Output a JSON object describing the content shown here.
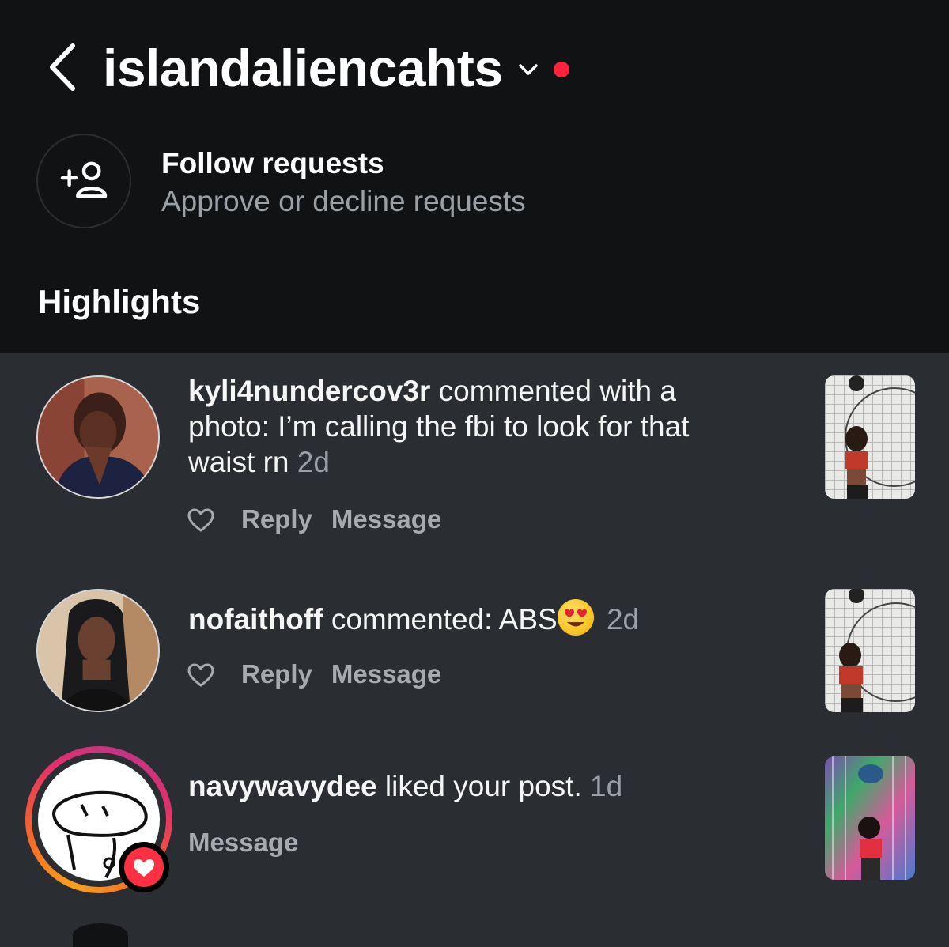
{
  "header": {
    "username": "islandaliencahts"
  },
  "follow_requests": {
    "title": "Follow requests",
    "subtitle": "Approve or decline requests"
  },
  "section_title": "Highlights",
  "notifications": [
    {
      "username": "kyli4nundercov3r",
      "line1_text": " commented with a",
      "line2": "photo: I’m calling the fbi to look for that",
      "line3": "waist rn",
      "time": "2d",
      "reply": "Reply",
      "message": "Message"
    },
    {
      "username": "nofaithoff",
      "text": " commented: ABS",
      "time": "2d",
      "reply": "Reply",
      "message": "Message"
    },
    {
      "username": "navywavydee",
      "text": " liked your post.",
      "time": "1d",
      "message": "Message"
    }
  ],
  "colors": {
    "header_bg": "#111214",
    "list_bg": "#2a2d31",
    "unread_dot": "#ff2238",
    "muted_text": "#9aa0a6"
  }
}
